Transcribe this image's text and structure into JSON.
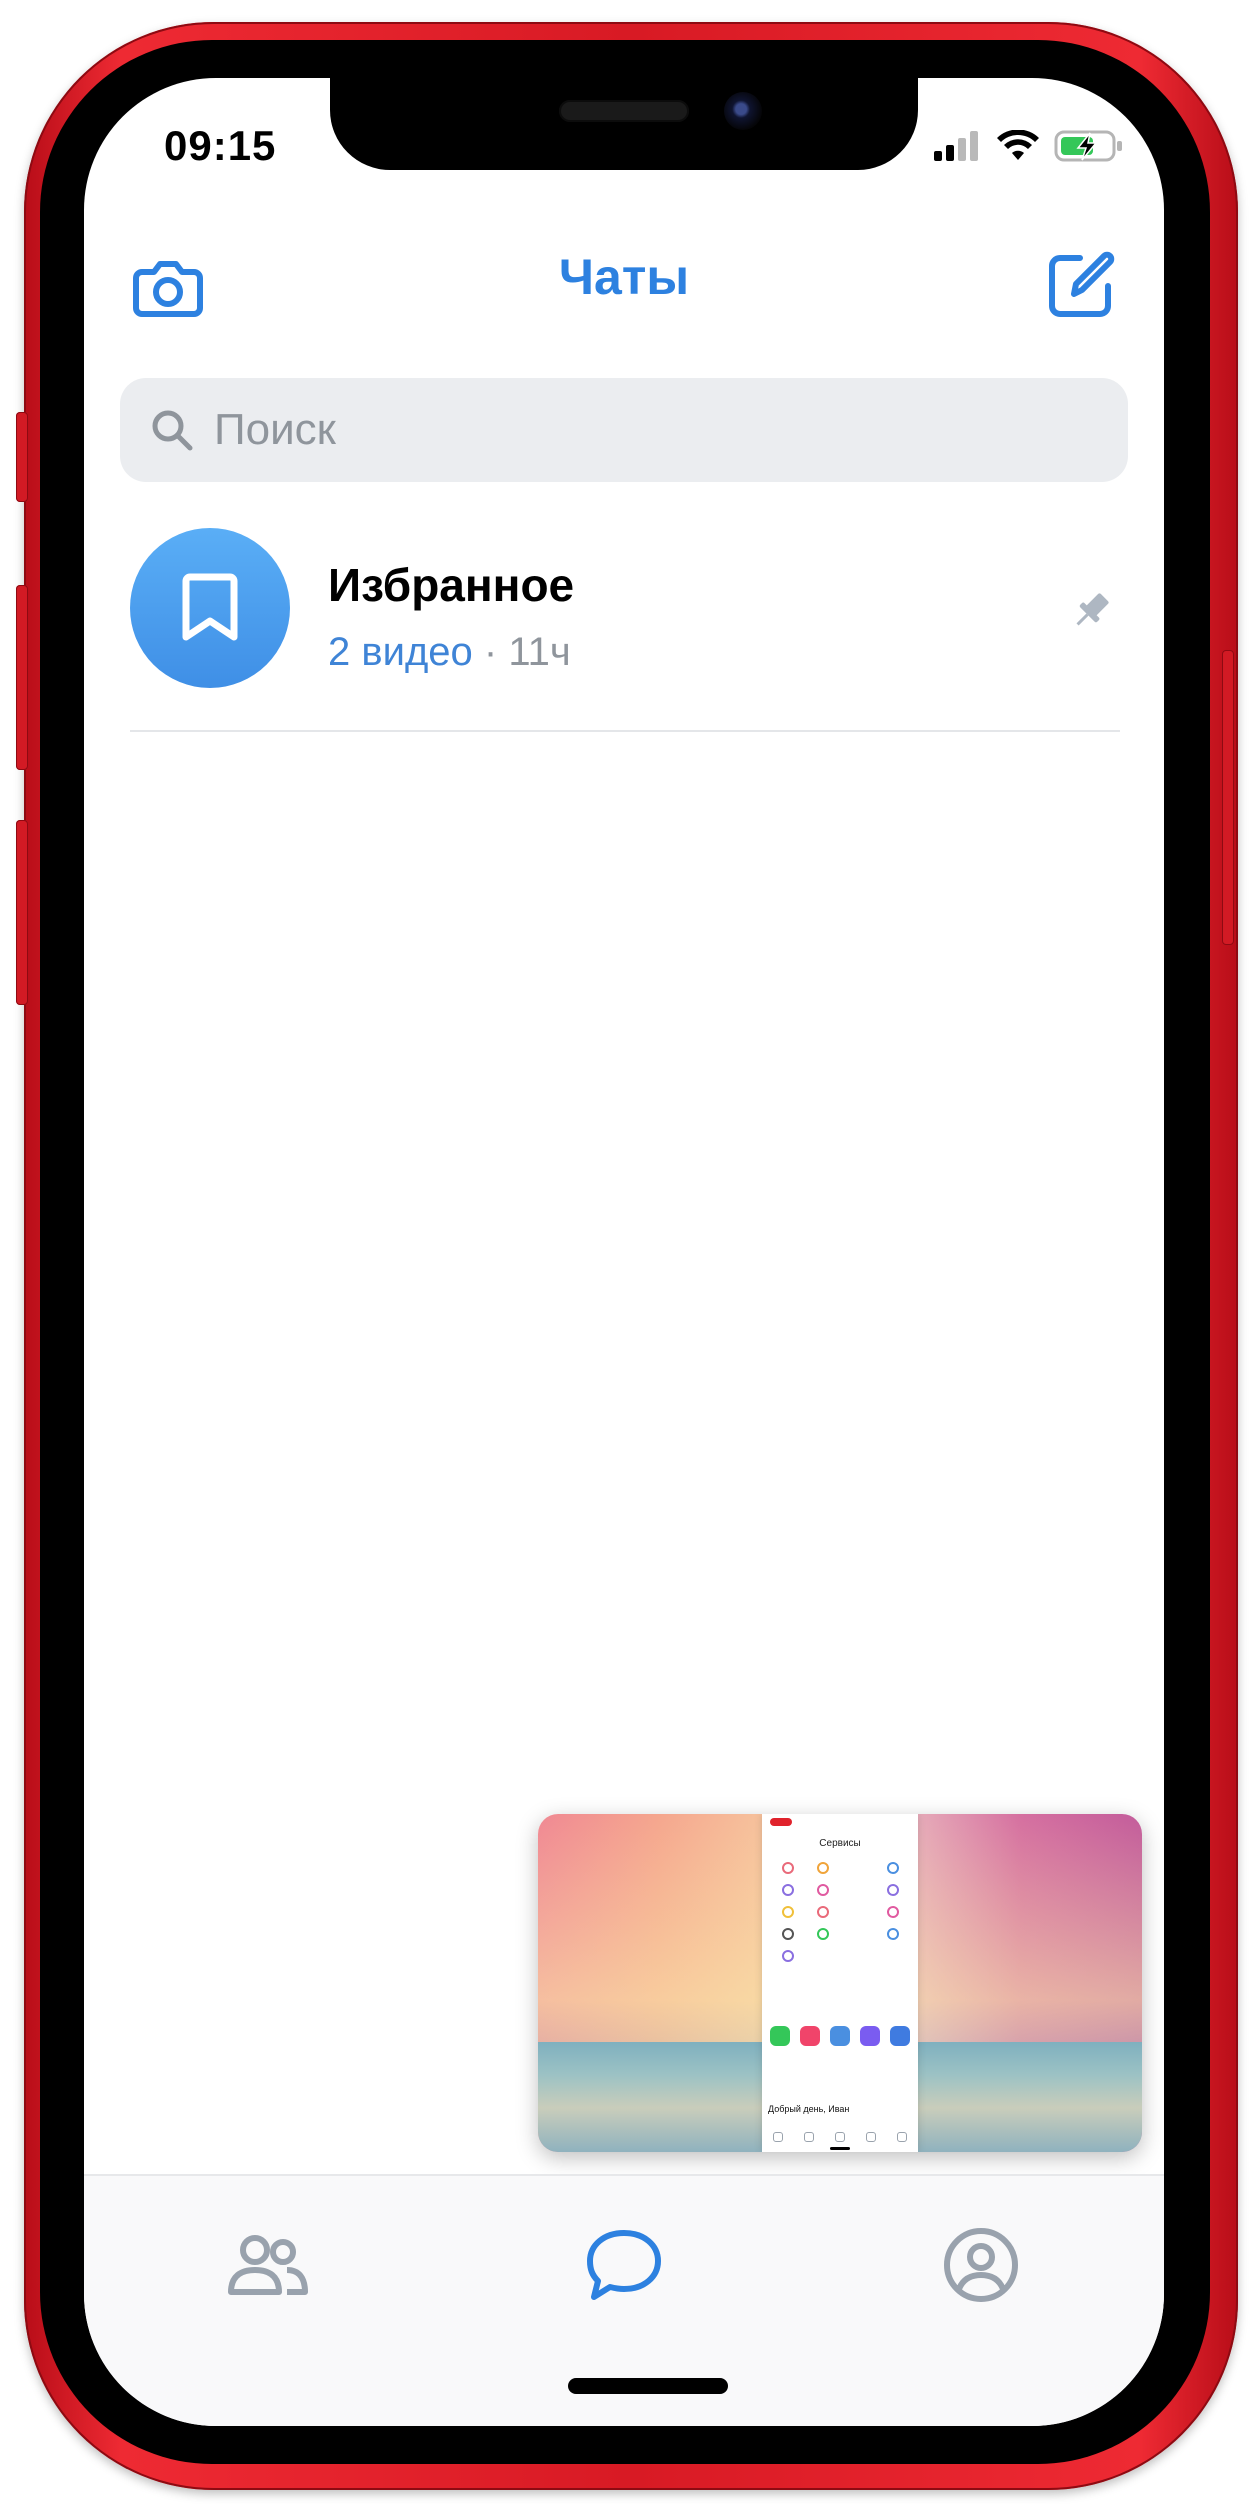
{
  "status_bar": {
    "time": "09:15"
  },
  "header": {
    "title": "Чаты",
    "left_icon": "camera-icon",
    "right_icon": "compose-icon"
  },
  "search": {
    "placeholder": "Поиск"
  },
  "chats": [
    {
      "name": "Избранное",
      "preview": "2 видео",
      "separator": " · ",
      "time": "11ч",
      "avatar_icon": "bookmark-icon",
      "pinned": true
    }
  ],
  "pip_preview": {
    "screen_title": "Сервисы",
    "greeting": "Добрый день, Иван"
  },
  "tabbar": {
    "items": [
      {
        "icon": "friends-icon",
        "active": false
      },
      {
        "icon": "chats-icon",
        "active": true
      },
      {
        "icon": "profile-icon",
        "active": false
      }
    ]
  },
  "colors": {
    "accent": "#2d81e0",
    "avatar_blue": "#4b9ef0",
    "phone_frame": "#e0222c",
    "search_bg": "#ebedf0",
    "secondary_text": "#8f959c",
    "tab_inactive": "#99a2ad"
  }
}
